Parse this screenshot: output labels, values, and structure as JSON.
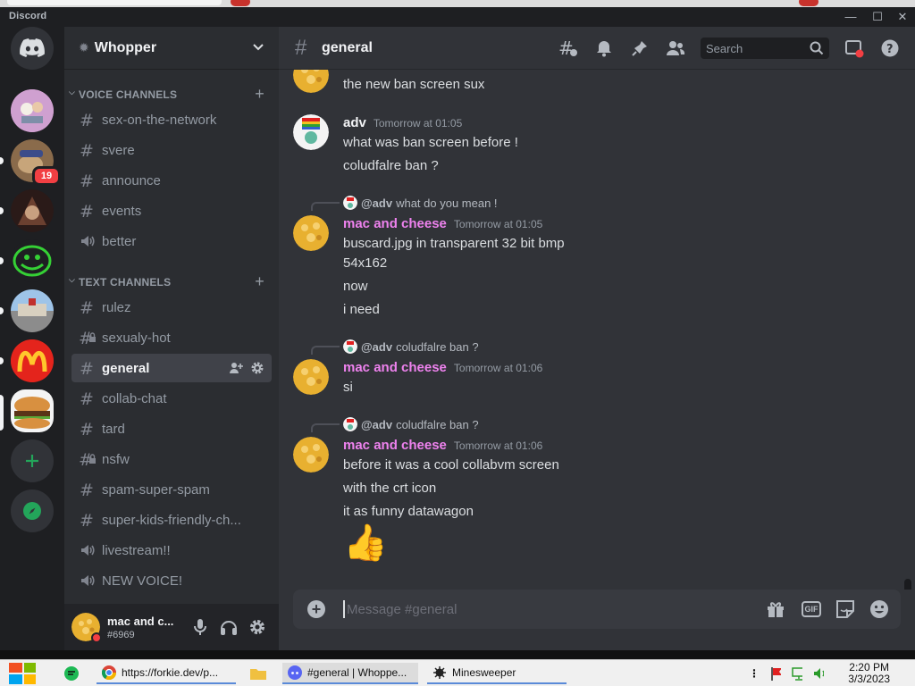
{
  "app": {
    "title": "Discord"
  },
  "colors": {
    "accent": "#5865f2",
    "mention_pink": "#ee82ee",
    "danger": "#f23f43",
    "online": "#23a55a"
  },
  "guilds": {
    "unread_badge": "19"
  },
  "server": {
    "name": "Whopper"
  },
  "sidebar": {
    "voice_category": "VOICE CHANNELS",
    "text_category": "TEXT CHANNELS",
    "voice_channels": [
      {
        "name": "sex-on-the-network",
        "icon": "hash-icon"
      },
      {
        "name": "svere",
        "icon": "hash-icon"
      },
      {
        "name": "announce",
        "icon": "hash-icon"
      },
      {
        "name": "events",
        "icon": "hash-icon"
      },
      {
        "name": "better",
        "icon": "speaker-icon"
      }
    ],
    "text_channels": [
      {
        "name": "rulez",
        "icon": "hash-icon"
      },
      {
        "name": "sexualy-hot",
        "icon": "hash-lock-icon"
      },
      {
        "name": "general",
        "icon": "hash-icon"
      },
      {
        "name": "collab-chat",
        "icon": "hash-icon"
      },
      {
        "name": "tard",
        "icon": "hash-icon"
      },
      {
        "name": "nsfw",
        "icon": "hash-lock-icon"
      },
      {
        "name": "spam-super-spam",
        "icon": "hash-icon"
      },
      {
        "name": "super-kids-friendly-ch...",
        "icon": "hash-icon"
      },
      {
        "name": "livestream!!",
        "icon": "speaker-icon"
      },
      {
        "name": "NEW VOICE!",
        "icon": "speaker-icon"
      }
    ]
  },
  "user": {
    "name": "mac and c...",
    "tag": "#6969"
  },
  "channel": {
    "name": "general",
    "search_placeholder": "Search"
  },
  "messages": {
    "m0": {
      "text": "the new ban screen sux"
    },
    "m1": {
      "author": "adv",
      "time": "Tomorrow at 01:05",
      "lines": [
        "what was ban screen before !",
        "coludfalre ban ?"
      ]
    },
    "m2": {
      "reply_to": "@adv",
      "reply_text": "what do you mean !",
      "author": "mac and cheese",
      "time": "Tomorrow at 01:05",
      "lines": [
        "buscard.jpg in transparent 32 bit bmp",
        "54x162",
        "now",
        "i need"
      ]
    },
    "m3": {
      "reply_to": "@adv",
      "reply_text": "coludfalre ban ?",
      "author": "mac and cheese",
      "time": "Tomorrow at 01:06",
      "lines": [
        "si"
      ]
    },
    "m4": {
      "reply_to": "@adv",
      "reply_text": "coludfalre ban ?",
      "author": "mac and cheese",
      "time": "Tomorrow at 01:06",
      "lines": [
        "before it was a cool collabvm screen",
        "with the crt icon",
        "it as funny datawagon"
      ],
      "emoji": "👍"
    }
  },
  "composer": {
    "placeholder": "Message #general",
    "gif_label": "GIF"
  },
  "taskbar": {
    "items": [
      "https://forkie.dev/p...",
      "#general | Whoppe...",
      "Minesweeper"
    ],
    "time": "2:20 PM",
    "date": "3/3/2023"
  }
}
